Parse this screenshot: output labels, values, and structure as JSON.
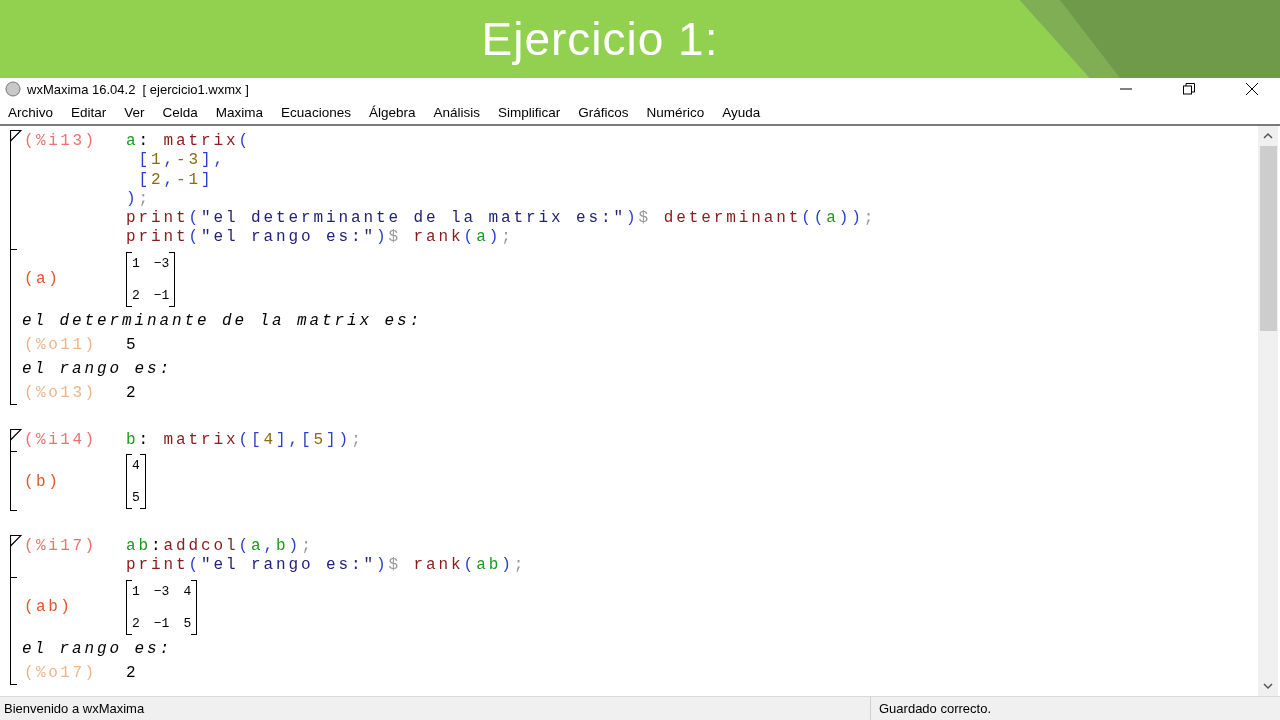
{
  "slide": {
    "title": "Ejercicio 1:"
  },
  "window": {
    "title": "wxMaxima 16.04.2  [ ejercicio1.wxmx ]"
  },
  "menu": [
    "Archivo",
    "Editar",
    "Ver",
    "Celda",
    "Maxima",
    "Ecuaciones",
    "Álgebra",
    "Análisis",
    "Simplificar",
    "Gráficos",
    "Numérico",
    "Ayuda"
  ],
  "cells": [
    {
      "input": {
        "label": "(%i13)",
        "lines": [
          [
            {
              "kind": "var",
              "text": "a"
            },
            {
              "kind": "op",
              "text": ": "
            },
            {
              "kind": "fn",
              "text": "matrix"
            },
            {
              "kind": "paren",
              "text": "("
            }
          ],
          [
            {
              "kind": "paren",
              "text": " ["
            },
            {
              "kind": "num",
              "text": "1"
            },
            {
              "kind": "paren",
              "text": ","
            },
            {
              "kind": "num",
              "text": "-3"
            },
            {
              "kind": "paren",
              "text": "],"
            }
          ],
          [
            {
              "kind": "paren",
              "text": " ["
            },
            {
              "kind": "num",
              "text": "2"
            },
            {
              "kind": "paren",
              "text": ","
            },
            {
              "kind": "num",
              "text": "-1"
            },
            {
              "kind": "paren",
              "text": "]"
            }
          ],
          [
            {
              "kind": "paren",
              "text": ")"
            },
            {
              "kind": "sep",
              "text": ";"
            }
          ],
          [
            {
              "kind": "fn",
              "text": "print"
            },
            {
              "kind": "paren",
              "text": "("
            },
            {
              "kind": "str",
              "text": "\"el determinante de la matrix es:\""
            },
            {
              "kind": "paren",
              "text": ")"
            },
            {
              "kind": "sep",
              "text": "$ "
            },
            {
              "kind": "fn",
              "text": "determinant"
            },
            {
              "kind": "paren",
              "text": "(("
            },
            {
              "kind": "var",
              "text": "a"
            },
            {
              "kind": "paren",
              "text": "))"
            },
            {
              "kind": "sep",
              "text": ";"
            }
          ],
          [
            {
              "kind": "fn",
              "text": "print"
            },
            {
              "kind": "paren",
              "text": "("
            },
            {
              "kind": "str",
              "text": "\"el rango es:\""
            },
            {
              "kind": "paren",
              "text": ")"
            },
            {
              "kind": "sep",
              "text": "$ "
            },
            {
              "kind": "fn",
              "text": "rank"
            },
            {
              "kind": "paren",
              "text": "("
            },
            {
              "kind": "var",
              "text": "a"
            },
            {
              "kind": "paren",
              "text": ")"
            },
            {
              "kind": "sep",
              "text": ";"
            }
          ]
        ]
      },
      "outputs": [
        {
          "kind": "matrix",
          "label": "(a)",
          "rows": [
            [
              "1",
              "−3"
            ],
            [
              "2",
              "−1"
            ]
          ]
        },
        {
          "kind": "text",
          "text": "el determinante de la matrix es:"
        },
        {
          "kind": "value",
          "label": "(%o11)",
          "value": "5"
        },
        {
          "kind": "text",
          "text": "el rango es:"
        },
        {
          "kind": "value",
          "label": "(%o13)",
          "value": "2"
        }
      ]
    },
    {
      "input": {
        "label": "(%i14)",
        "lines": [
          [
            {
              "kind": "var",
              "text": "b"
            },
            {
              "kind": "op",
              "text": ": "
            },
            {
              "kind": "fn",
              "text": "matrix"
            },
            {
              "kind": "paren",
              "text": "(["
            },
            {
              "kind": "num",
              "text": "4"
            },
            {
              "kind": "paren",
              "text": "],["
            },
            {
              "kind": "num",
              "text": "5"
            },
            {
              "kind": "paren",
              "text": "])"
            },
            {
              "kind": "sep",
              "text": ";"
            }
          ]
        ]
      },
      "outputs": [
        {
          "kind": "matrix",
          "label": "(b)",
          "rows": [
            [
              "4"
            ],
            [
              "5"
            ]
          ]
        }
      ]
    },
    {
      "input": {
        "label": "(%i17)",
        "lines": [
          [
            {
              "kind": "var",
              "text": "ab"
            },
            {
              "kind": "op",
              "text": ":"
            },
            {
              "kind": "fn",
              "text": "addcol"
            },
            {
              "kind": "paren",
              "text": "("
            },
            {
              "kind": "var",
              "text": "a"
            },
            {
              "kind": "paren",
              "text": ","
            },
            {
              "kind": "var",
              "text": "b"
            },
            {
              "kind": "paren",
              "text": ")"
            },
            {
              "kind": "sep",
              "text": ";"
            }
          ],
          [
            {
              "kind": "fn",
              "text": "print"
            },
            {
              "kind": "paren",
              "text": "("
            },
            {
              "kind": "str",
              "text": "\"el rango es:\""
            },
            {
              "kind": "paren",
              "text": ")"
            },
            {
              "kind": "sep",
              "text": "$ "
            },
            {
              "kind": "fn",
              "text": "rank"
            },
            {
              "kind": "paren",
              "text": "("
            },
            {
              "kind": "var",
              "text": "ab"
            },
            {
              "kind": "paren",
              "text": ")"
            },
            {
              "kind": "sep",
              "text": ";"
            }
          ]
        ]
      },
      "outputs": [
        {
          "kind": "matrix",
          "label": "(ab)",
          "rows": [
            [
              "1",
              "−3",
              "4"
            ],
            [
              "2",
              "−1",
              "5"
            ]
          ]
        },
        {
          "kind": "text",
          "text": "el rango es:"
        },
        {
          "kind": "value",
          "label": "(%o17)",
          "value": "2"
        }
      ]
    }
  ],
  "status_bar": [
    "Bienvenido a wxMaxima",
    "Guardado correcto."
  ]
}
